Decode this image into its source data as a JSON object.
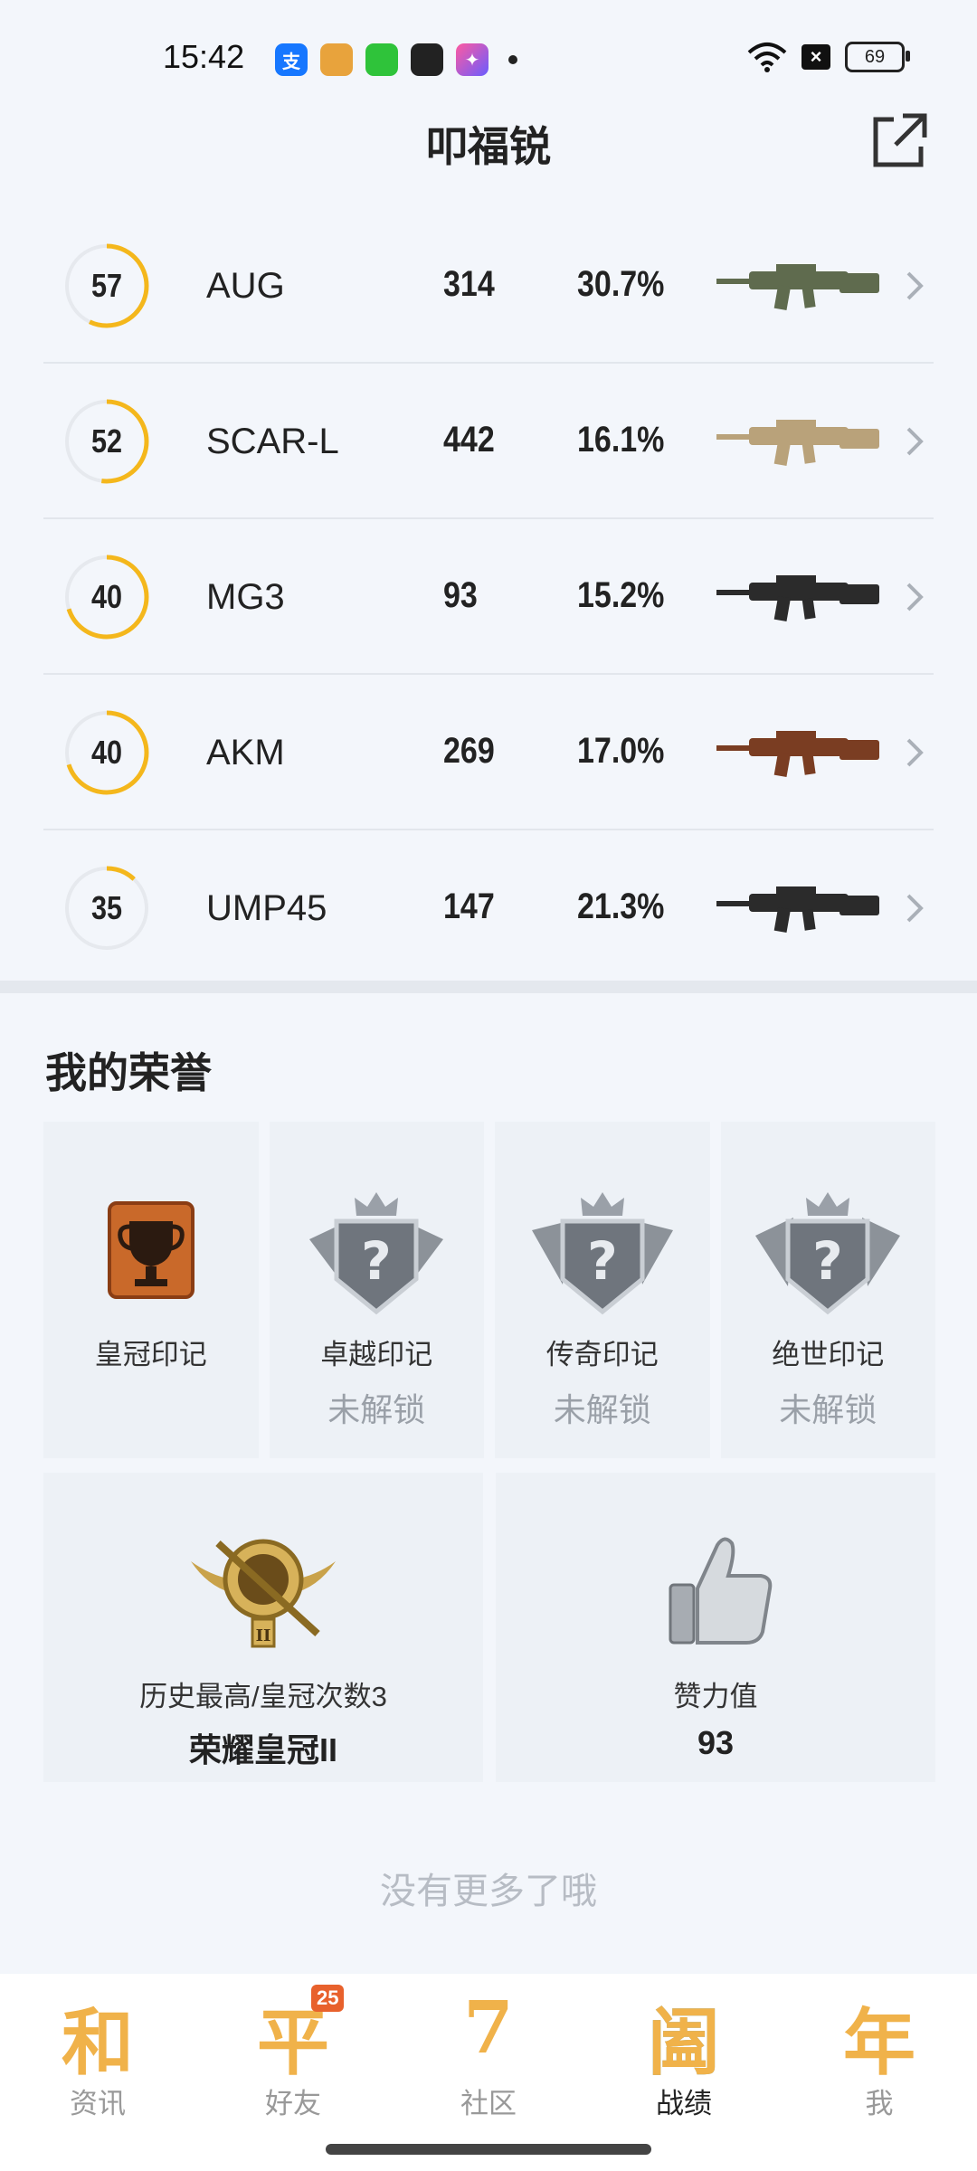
{
  "status_bar": {
    "time": "15:42",
    "battery": "69",
    "apps": [
      {
        "icon": "alipay-icon",
        "glyph": "支",
        "color": "#1677ff"
      },
      {
        "icon": "game-app-icon",
        "glyph": "",
        "color": "#e8a33c"
      },
      {
        "icon": "wechat-mini-icon",
        "glyph": "",
        "color": "#2fc33a"
      },
      {
        "icon": "shield-app-icon",
        "glyph": "",
        "color": "#222222"
      },
      {
        "icon": "star-app-icon",
        "glyph": "",
        "color": "#7a5cff"
      }
    ]
  },
  "header": {
    "title": "叩福锐"
  },
  "weapons": [
    {
      "level": "57",
      "progress": 0.57,
      "name": "AUG",
      "count": "314",
      "rate": "30.7%",
      "color": "#5f6b4e"
    },
    {
      "level": "52",
      "progress": 0.52,
      "name": "SCAR-L",
      "count": "442",
      "rate": "16.1%",
      "color": "#b9a27a"
    },
    {
      "level": "40",
      "progress": 0.7,
      "name": "MG3",
      "count": "93",
      "rate": "15.2%",
      "color": "#2b2b2b"
    },
    {
      "level": "40",
      "progress": 0.7,
      "name": "AKM",
      "count": "269",
      "rate": "17.0%",
      "color": "#7a3d22"
    },
    {
      "level": "35",
      "progress": 0.12,
      "name": "UMP45",
      "count": "147",
      "rate": "21.3%",
      "color": "#2b2b2b"
    }
  ],
  "honors": {
    "title": "我的荣誉",
    "badges": [
      {
        "name": "皇冠印记",
        "status": ""
      },
      {
        "name": "卓越印记",
        "status": "未解锁"
      },
      {
        "name": "传奇印记",
        "status": "未解锁"
      },
      {
        "name": "绝世印记",
        "status": "未解锁"
      }
    ],
    "stats": [
      {
        "label": "历史最高/皇冠次数3",
        "value": "荣耀皇冠II"
      },
      {
        "label": "赞力值",
        "value": "93"
      }
    ]
  },
  "end_text": "没有更多了哦",
  "nav": [
    {
      "glyph": "和",
      "label": "资讯",
      "badge": "",
      "active": false
    },
    {
      "glyph": "平",
      "label": "好友",
      "badge": "25",
      "active": false
    },
    {
      "glyph": "7",
      "label": "社区",
      "badge": "",
      "active": false
    },
    {
      "glyph": "阖",
      "label": "战绩",
      "badge": "",
      "active": true
    },
    {
      "glyph": "年",
      "label": "我",
      "badge": "",
      "active": false
    }
  ],
  "colors": {
    "ring": "#f4b71c",
    "ring_track": "#e6e9ee"
  }
}
